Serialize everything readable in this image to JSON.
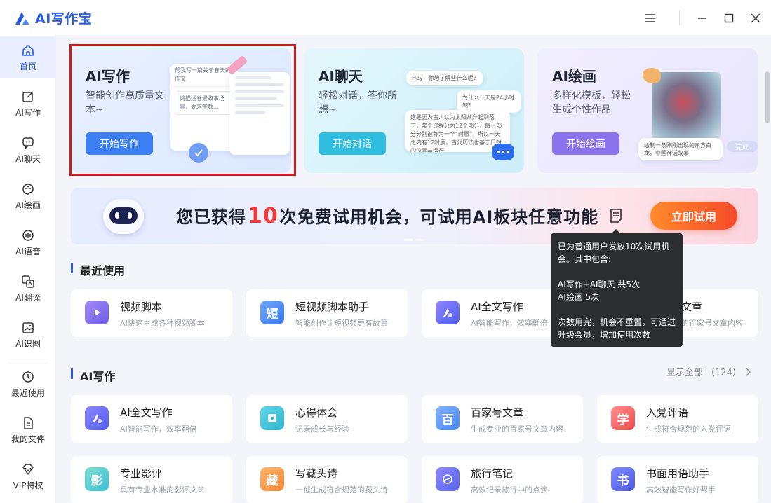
{
  "app": {
    "title": "AI写作宝"
  },
  "sidebar": {
    "items": [
      {
        "label": "首页",
        "icon": "home-icon"
      },
      {
        "label": "AI写作",
        "icon": "edit-icon"
      },
      {
        "label": "AI聊天",
        "icon": "chat-icon"
      },
      {
        "label": "AI绘画",
        "icon": "palette-icon"
      },
      {
        "label": "AI语音",
        "icon": "voice-icon"
      },
      {
        "label": "AI翻译",
        "icon": "translate-icon"
      },
      {
        "label": "AI识图",
        "icon": "image-recognition-icon"
      },
      {
        "label": "最近使用",
        "icon": "history-icon"
      },
      {
        "label": "我的文件",
        "icon": "file-icon"
      },
      {
        "label": "VIP特权",
        "icon": "vip-icon"
      }
    ]
  },
  "features": [
    {
      "title": "AI写作",
      "desc": "智能创作高质量文本~",
      "button": "开始写作",
      "mock_title": "帮我写一篇关于春天的作文",
      "mock_body": "请描述春景故事场景，要求字数..."
    },
    {
      "title": "AI聊天",
      "desc": "轻松对话，答你所想~",
      "button": "开始对话",
      "bubble1": "Hey，你想了解些什么呢?",
      "bubble2": "为什么一天是24小时制?",
      "bubble3": "这是因为古人认为太阳从升起到落下，整个过程分为12个部分，每一部分分别被称为一个“时辰”，所以一天之内有12时辰，古代历法也基于日时的位置与运行..."
    },
    {
      "title": "AI绘画",
      "desc": "多样化模板，轻松生成个性作品",
      "button": "开始绘画",
      "caption": "绘制一条刚刚出现的东方白龙，中国神话故事",
      "done": "完成"
    }
  ],
  "banner": {
    "text_before": "您已获得",
    "count": "10",
    "text_after": "次免费试用机会，可试用AI板块任意功能",
    "button": "立即试用"
  },
  "tooltip": {
    "line1": "已为普通用户发放10次试用机会。其中包含:",
    "line2": "AI写作+AI聊天 共5次",
    "line3": "AI绘画 5次",
    "line4": "次数用完，机会不重置，可通过升级会员，增加使用次数"
  },
  "recent": {
    "title": "最近使用",
    "items": [
      {
        "name": "视频脚本",
        "desc": "AI快速生成各种视频脚本"
      },
      {
        "name": "短视频脚本助手",
        "desc": "智能创作让短视频更有故事"
      },
      {
        "name": "AI全文写作",
        "desc": "AI智能写作，效率翻倍"
      },
      {
        "name": "文章",
        "desc": "的百家号文章内容"
      }
    ]
  },
  "writing": {
    "title": "AI写作",
    "show_all": "显示全部",
    "count": "（124）",
    "items": [
      {
        "name": "AI全文写作",
        "desc": "AI智能写作，效率翻倍"
      },
      {
        "name": "心得体会",
        "desc": "记录成长与经验"
      },
      {
        "name": "百家号文章",
        "desc": "生成专业的百家号文章内容"
      },
      {
        "name": "入党评语",
        "desc": "生成符合规范的入党评语"
      },
      {
        "name": "专业影评",
        "desc": "具有专业水准的影评文章"
      },
      {
        "name": "写藏头诗",
        "desc": "一键生成符合规范的藏头诗"
      },
      {
        "name": "旅行笔记",
        "desc": "高效记录旅行中的点滴"
      },
      {
        "name": "书面用语助手",
        "desc": "高效智能写作好帮手"
      }
    ],
    "icon_glyphs": {
      "baijia": "百",
      "rudang": "学",
      "yingping": "影",
      "cangtou": "藏",
      "shumian": "书",
      "duan": "短"
    }
  },
  "colors": {
    "accent": "#2b5ce6",
    "highlight": "#d01b1b",
    "cta": "#f54a2a"
  }
}
